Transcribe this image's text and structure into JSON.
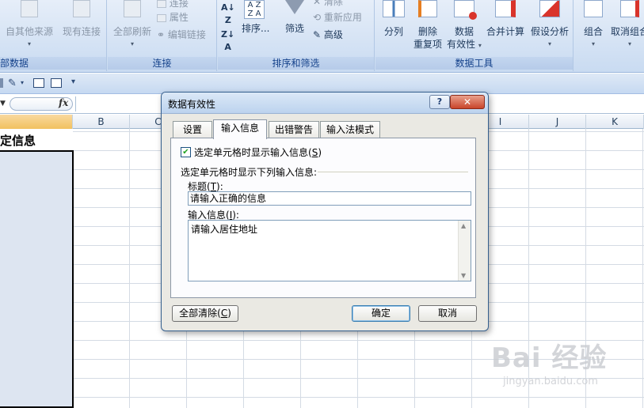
{
  "ribbon": {
    "get_external": {
      "other_sources": "自其他来源",
      "existing_connections": "现有连接",
      "group_label": "部数据"
    },
    "connections": {
      "refresh_all": "全部刷新",
      "connections": "连接",
      "properties": "属性",
      "edit_links": "编辑链接",
      "group_label": "连接"
    },
    "sort_filter": {
      "sort": "排序...",
      "filter": "筛选",
      "clear": "清除",
      "reapply": "重新应用",
      "advanced": "高级",
      "group_label": "排序和筛选"
    },
    "data_tools": {
      "text_to_columns": "分列",
      "remove_dup_1": "删除",
      "remove_dup_2": "重复项",
      "validation_1": "数据",
      "validation_2": "有效性",
      "consolidate": "合并计算",
      "what_if": "假设分析",
      "group_label": "数据工具"
    },
    "outline": {
      "group": "组合",
      "ungroup": "取消组合"
    }
  },
  "formula_bar": {
    "fx": "fx"
  },
  "sheet": {
    "columns": [
      "B",
      "C",
      "I",
      "J",
      "K"
    ],
    "cell_a1": "定信息"
  },
  "dialog": {
    "title": "数据有效性",
    "help": "?",
    "close": "✕",
    "tabs": [
      "设置",
      "输入信息",
      "出错警告",
      "输入法模式"
    ],
    "checkbox_label": "选定单元格时显示输入信息",
    "checkbox_key": "S",
    "checkbox_checked": true,
    "group_label": "选定单元格时显示下列输入信息:",
    "title_label": "标题",
    "title_key": "T",
    "title_value": "请输入正确的信息",
    "message_label": "输入信息",
    "message_key": "I",
    "message_value": "请输入居住地址",
    "clear_all": "全部清除",
    "clear_all_key": "C",
    "ok": "确定",
    "cancel": "取消"
  },
  "watermark": {
    "main": "Bai 经验",
    "sub": "jingyan.baidu.com"
  }
}
